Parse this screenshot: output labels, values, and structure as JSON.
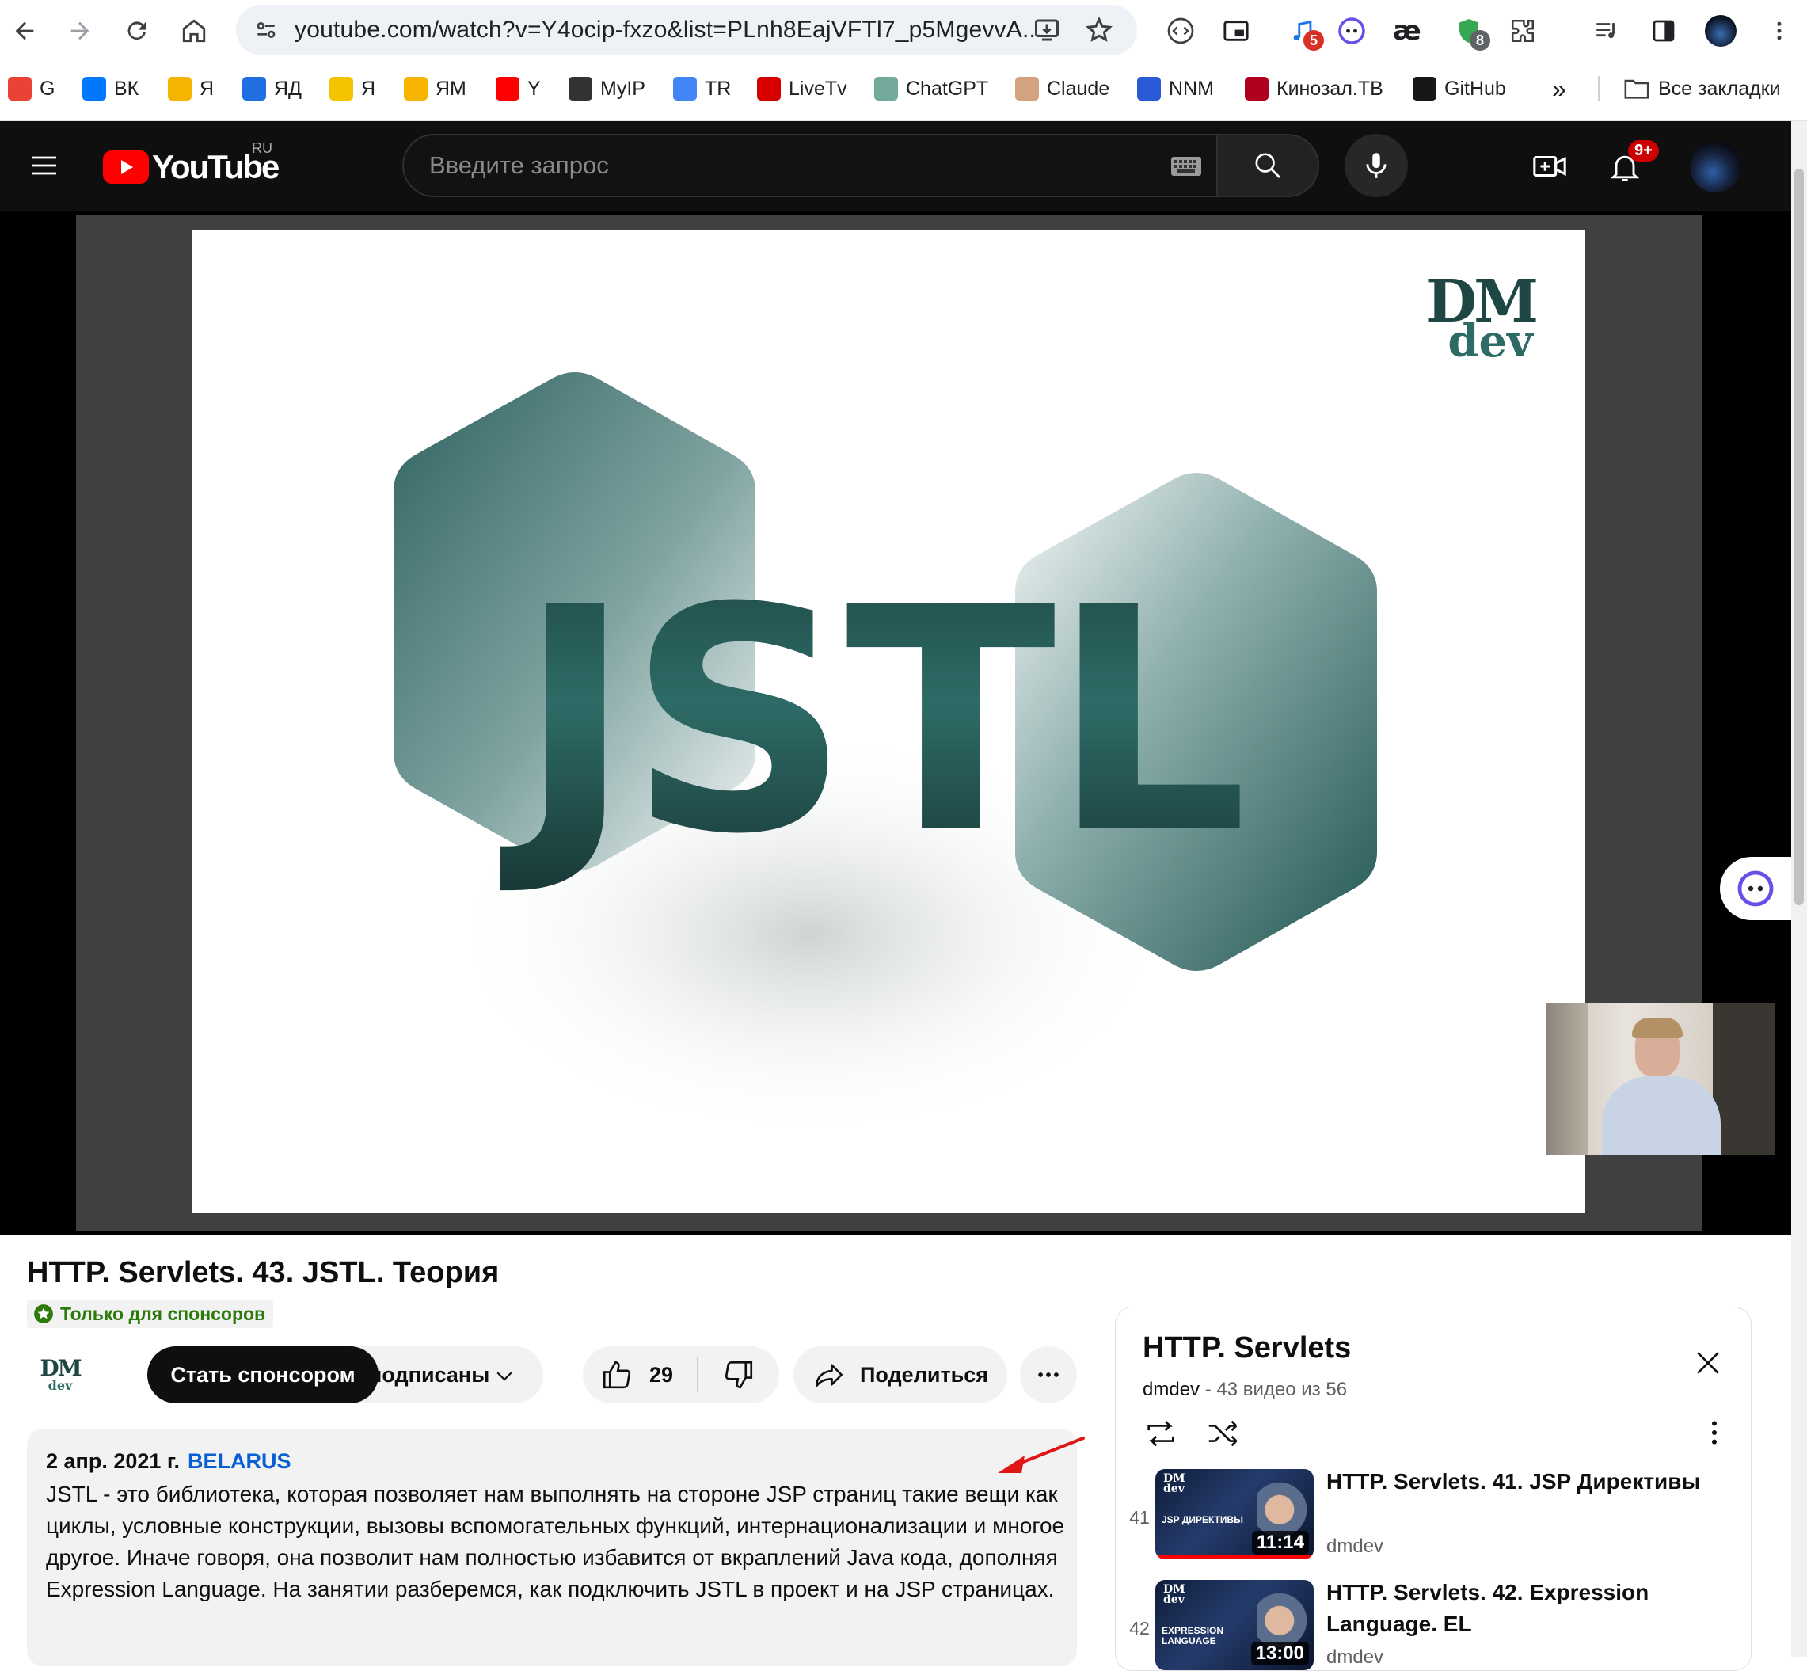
{
  "browser": {
    "url": "youtube.com/watch?v=Y4ocip-fxzo&list=PLnh8EajVFTl7_p5MgevvA...",
    "extension_badges": {
      "ext_2": "5",
      "shield": "8"
    },
    "bookmarks": [
      {
        "label": "G",
        "icon": "gmail-icon",
        "color": "#ea4335"
      },
      {
        "label": "ВК",
        "icon": "vk-icon",
        "color": "#0077ff"
      },
      {
        "label": "Я",
        "icon": "yandex-mail-icon",
        "color": "#f5b400"
      },
      {
        "label": "ЯД",
        "icon": "yandex-disk-icon",
        "color": "#1f6fe0"
      },
      {
        "label": "Я",
        "icon": "yandex-market-icon",
        "color": "#f5c400"
      },
      {
        "label": "ЯМ",
        "icon": "yandex-music-icon",
        "color": "#f5b400"
      },
      {
        "label": "Y",
        "icon": "youtube-icon",
        "color": "#ff0000"
      },
      {
        "label": "MyIP",
        "icon": "globe-icon",
        "color": "#333333"
      },
      {
        "label": "TR",
        "icon": "translate-icon",
        "color": "#4285f4"
      },
      {
        "label": "LiveTv",
        "icon": "livetv-icon",
        "color": "#d60000"
      },
      {
        "label": "ChatGPT",
        "icon": "chatgpt-icon",
        "color": "#74aa9c"
      },
      {
        "label": "Claude",
        "icon": "claude-icon",
        "color": "#d4a27f"
      },
      {
        "label": "NNM",
        "icon": "nnm-icon",
        "color": "#2a5bd7"
      },
      {
        "label": "Кинозал.ТВ",
        "icon": "kinozal-icon",
        "color": "#b00020"
      },
      {
        "label": "GitHub",
        "icon": "github-icon",
        "color": "#181717"
      }
    ],
    "more_bookmarks": "»",
    "all_bookmarks": "Все закладки"
  },
  "youtube": {
    "logo_text": "YouTube",
    "region": "RU",
    "search_placeholder": "Введите запрос",
    "notifications_badge": "9+"
  },
  "player": {
    "slide_word": "JSTL",
    "logo_dm": "DM",
    "logo_dev": "dev"
  },
  "video": {
    "title": "HTTP. Servlets. 43. JSTL. Теория",
    "members_only": "Только для спонсоров",
    "channel_avatar_dm": "DM",
    "channel_avatar_dev": "dev",
    "sponsor_button": "Стать спонсором",
    "subscribed_button": "Вы подписаны",
    "likes": "29",
    "share": "Поделиться",
    "date": "2 апр. 2021 г.",
    "tag": "BELARUS",
    "description": "JSTL - это библиотека, которая позволяет нам выполнять на стороне JSP страниц такие вещи как циклы, условные конструкции, вызовы вспомогательных функций, интернационализации и многое другое. Иначе говоря, она позволит нам полностью избавится от вкраплений Java кода, дополняя Expression Language. На занятии разберемся, как подключить JSTL в проект и на JSP страницах."
  },
  "playlist": {
    "title": "HTTP. Servlets",
    "channel": "dmdev",
    "progress": "43 видео из 56",
    "items": [
      {
        "index": "41",
        "title": "HTTP. Servlets. 41. JSP Директивы",
        "channel": "dmdev",
        "duration": "11:14",
        "thumb_text": "JSP ДИРЕКТИВЫ",
        "watched_fraction": 1.0
      },
      {
        "index": "42",
        "title": "HTTP. Servlets. 42. Expression Language. EL",
        "channel": "dmdev",
        "duration": "13:00",
        "thumb_text": "EXPRESSION LANGUAGE",
        "watched_fraction": 0
      }
    ]
  },
  "colors": {
    "yt_red": "#ff0000",
    "sponsor_bg": "#0f0f0f",
    "members_green": "#2b7a0b",
    "link_blue": "#065fd4",
    "jstl_teal": "#1f4d4a",
    "annotation_red": "#e01515"
  }
}
